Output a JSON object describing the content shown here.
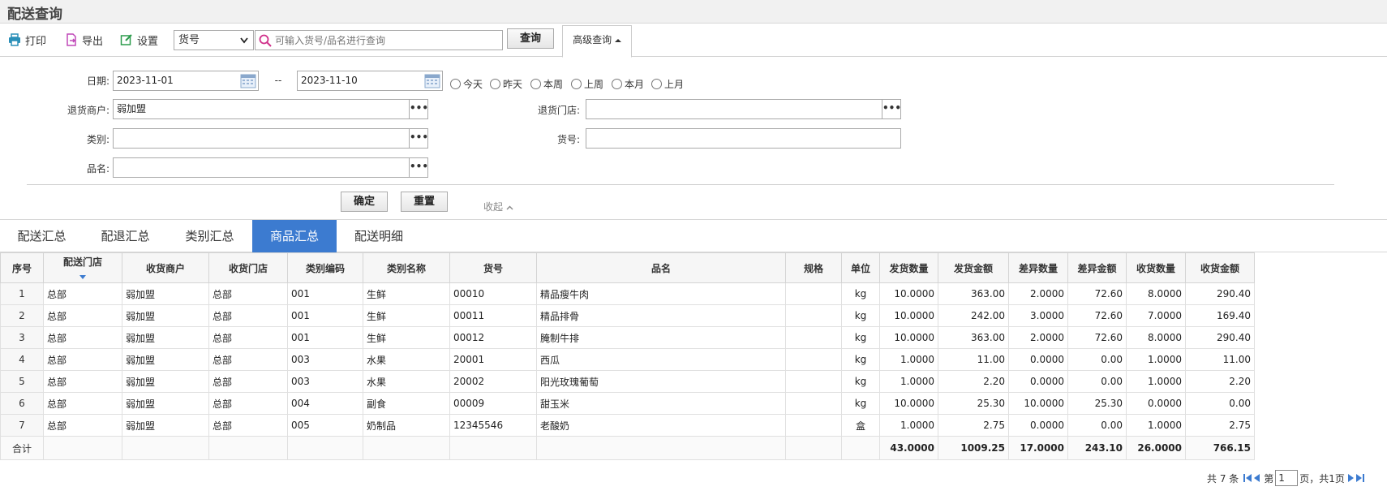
{
  "page": {
    "title": "配送查询"
  },
  "toolbar": {
    "print_label": "打印",
    "export_label": "导出",
    "settings_label": "设置",
    "field_select": "货号",
    "search_placeholder": "可输入货号/品名进行查询",
    "search_button": "查询",
    "advanced_tab": "高级查询"
  },
  "filter": {
    "date_label": "日期:",
    "date_from": "2023-11-01",
    "date_sep": "--",
    "date_to": "2023-11-10",
    "quick_dates": [
      "今天",
      "昨天",
      "本周",
      "上周",
      "本月",
      "上月"
    ],
    "merchant_label": "退货商户:",
    "merchant_value": "弱加盟",
    "store_label": "退货门店:",
    "store_value": "",
    "category_label": "类别:",
    "category_value": "",
    "sku_label": "货号:",
    "sku_value": "",
    "name_label": "品名:",
    "name_value": "",
    "dots": "•••",
    "confirm_button": "确定",
    "reset_button": "重置",
    "collapse_label": "收起"
  },
  "tabs": [
    "配送汇总",
    "配退汇总",
    "类别汇总",
    "商品汇总",
    "配送明细"
  ],
  "active_tab": 3,
  "table": {
    "headers": [
      "序号",
      "配送门店",
      "收货商户",
      "收货门店",
      "类别编码",
      "类别名称",
      "货号",
      "品名",
      "规格",
      "单位",
      "发货数量",
      "发货金额",
      "差异数量",
      "差异金额",
      "收货数量",
      "收货金额"
    ],
    "rows": [
      [
        "1",
        "总部",
        "弱加盟",
        "总部",
        "001",
        "生鲜",
        "00010",
        "精品瘦牛肉",
        "",
        "kg",
        "10.0000",
        "363.00",
        "2.0000",
        "72.60",
        "8.0000",
        "290.40"
      ],
      [
        "2",
        "总部",
        "弱加盟",
        "总部",
        "001",
        "生鲜",
        "00011",
        "精品排骨",
        "",
        "kg",
        "10.0000",
        "242.00",
        "3.0000",
        "72.60",
        "7.0000",
        "169.40"
      ],
      [
        "3",
        "总部",
        "弱加盟",
        "总部",
        "001",
        "生鲜",
        "00012",
        "腌制牛排",
        "",
        "kg",
        "10.0000",
        "363.00",
        "2.0000",
        "72.60",
        "8.0000",
        "290.40"
      ],
      [
        "4",
        "总部",
        "弱加盟",
        "总部",
        "003",
        "水果",
        "20001",
        "西瓜",
        "",
        "kg",
        "1.0000",
        "11.00",
        "0.0000",
        "0.00",
        "1.0000",
        "11.00"
      ],
      [
        "5",
        "总部",
        "弱加盟",
        "总部",
        "003",
        "水果",
        "20002",
        "阳光玫瑰葡萄",
        "",
        "kg",
        "1.0000",
        "2.20",
        "0.0000",
        "0.00",
        "1.0000",
        "2.20"
      ],
      [
        "6",
        "总部",
        "弱加盟",
        "总部",
        "004",
        "副食",
        "00009",
        "甜玉米",
        "",
        "kg",
        "10.0000",
        "25.30",
        "10.0000",
        "25.30",
        "0.0000",
        "0.00"
      ],
      [
        "7",
        "总部",
        "弱加盟",
        "总部",
        "005",
        "奶制品",
        "12345546",
        "老酸奶",
        "",
        "盒",
        "1.0000",
        "2.75",
        "0.0000",
        "0.00",
        "1.0000",
        "2.75"
      ]
    ],
    "total_label": "合计",
    "totals": [
      "43.0000",
      "1009.25",
      "17.0000",
      "243.10",
      "26.0000",
      "766.15"
    ]
  },
  "pager": {
    "summary": "共 7 条",
    "page_prefix": "第",
    "page_value": "1",
    "page_suffix": "页，共1页"
  },
  "colors": {
    "accent": "#3c7bd0",
    "print_icon": "#2a8fb8",
    "export_icon": "#c048b8",
    "settings_icon": "#2a9a4a",
    "search_icon": "#d0308a"
  }
}
